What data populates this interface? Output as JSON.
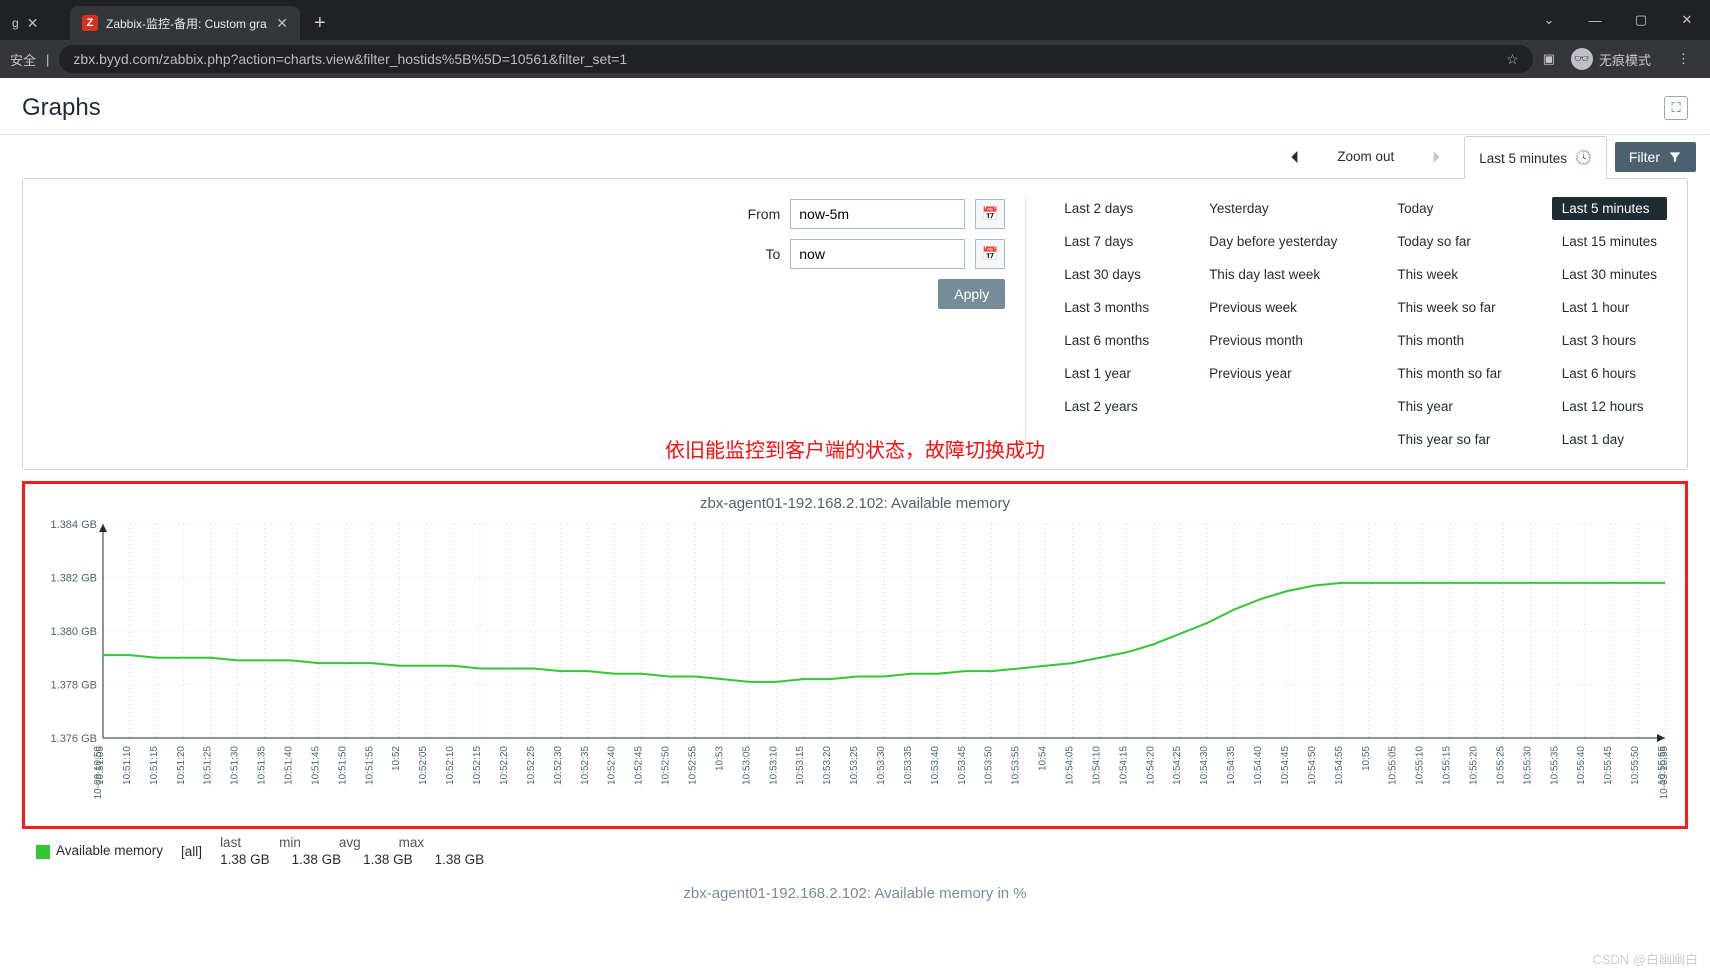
{
  "browser": {
    "tab1_close": "✕",
    "active_tab_title": "Zabbix-监控-备用: Custom gra",
    "newtab": "+",
    "win_min": "—",
    "win_max": "▢",
    "win_close": "✕",
    "addr_prefix": "安全",
    "url": "zbx.byyd.com/zabbix.php?action=charts.view&filter_hostids%5B%5D=10561&filter_set=1",
    "star": "☆",
    "ext": "▣",
    "incognito": "无痕模式",
    "menu": "⋮",
    "dropdown": "⌄"
  },
  "page": {
    "title": "Graphs",
    "fullscreen_icon": "⛶"
  },
  "toolbar": {
    "prev": "‹",
    "zoom": "Zoom out",
    "next": "›",
    "time_label": "Last 5 minutes",
    "filter_label": "Filter"
  },
  "filter": {
    "from_label": "From",
    "from_value": "now-5m",
    "to_label": "To",
    "to_value": "now",
    "apply": "Apply"
  },
  "presets": {
    "col1": [
      "Last 2 days",
      "Last 7 days",
      "Last 30 days",
      "Last 3 months",
      "Last 6 months",
      "Last 1 year",
      "Last 2 years"
    ],
    "col2": [
      "Yesterday",
      "Day before yesterday",
      "This day last week",
      "Previous week",
      "Previous month",
      "Previous year"
    ],
    "col3": [
      "Today",
      "Today so far",
      "This week",
      "This week so far",
      "This month",
      "This month so far",
      "This year",
      "This year so far"
    ],
    "col4": [
      "Last 5 minutes",
      "Last 15 minutes",
      "Last 30 minutes",
      "Last 1 hour",
      "Last 3 hours",
      "Last 6 hours",
      "Last 12 hours",
      "Last 1 day"
    ],
    "selected": "Last 5 minutes"
  },
  "annotation": "依旧能监控到客户端的状态，故障切换成功",
  "legend": {
    "series": "Available memory",
    "scope": "[all]",
    "headers": [
      "last",
      "min",
      "avg",
      "max"
    ],
    "values": [
      "1.38 GB",
      "1.38 GB",
      "1.38 GB",
      "1.38 GB"
    ]
  },
  "chart2_title": "zbx-agent01-192.168.2.102: Available memory in %",
  "watermark": "CSDN @白幽幽白",
  "chart_data": {
    "type": "line",
    "title": "zbx-agent01-192.168.2.102: Available memory",
    "xlabel": "",
    "ylabel": "",
    "y_ticks": [
      "1.376 GB",
      "1.378 GB",
      "1.380 GB",
      "1.382 GB",
      "1.384 GB"
    ],
    "ylim": [
      1.376,
      1.384
    ],
    "x_left_label": "10-09 10:50",
    "x_right_label": "10-09 10:55",
    "categories": [
      "10:51:05",
      "10:51:10",
      "10:51:15",
      "10:51:20",
      "10:51:25",
      "10:51:30",
      "10:51:35",
      "10:51:40",
      "10:51:45",
      "10:51:50",
      "10:51:55",
      "10:52",
      "10:52:05",
      "10:52:10",
      "10:52:15",
      "10:52:20",
      "10:52:25",
      "10:52:30",
      "10:52:35",
      "10:52:40",
      "10:52:45",
      "10:52:50",
      "10:52:55",
      "10:53",
      "10:53:05",
      "10:53:10",
      "10:53:15",
      "10:53:20",
      "10:53:25",
      "10:53:30",
      "10:53:35",
      "10:53:40",
      "10:53:45",
      "10:53:50",
      "10:53:55",
      "10:54",
      "10:54:05",
      "10:54:10",
      "10:54:15",
      "10:54:20",
      "10:54:25",
      "10:54:30",
      "10:54:35",
      "10:54:40",
      "10:54:45",
      "10:54:50",
      "10:54:55",
      "10:55",
      "10:55:05",
      "10:55:10",
      "10:55:15",
      "10:55:20",
      "10:55:25",
      "10:55:30",
      "10:55:35",
      "10:55:40",
      "10:55:45",
      "10:55:50",
      "10:55:55"
    ],
    "series": [
      {
        "name": "Available memory",
        "color": "#34c634",
        "values": [
          1.3791,
          1.3791,
          1.379,
          1.379,
          1.379,
          1.3789,
          1.3789,
          1.3789,
          1.3788,
          1.3788,
          1.3788,
          1.3787,
          1.3787,
          1.3787,
          1.3786,
          1.3786,
          1.3786,
          1.3785,
          1.3785,
          1.3784,
          1.3784,
          1.3783,
          1.3783,
          1.3782,
          1.3781,
          1.3781,
          1.3782,
          1.3782,
          1.3783,
          1.3783,
          1.3784,
          1.3784,
          1.3785,
          1.3785,
          1.3786,
          1.3787,
          1.3788,
          1.379,
          1.3792,
          1.3795,
          1.3799,
          1.3803,
          1.3808,
          1.3812,
          1.3815,
          1.3817,
          1.3818,
          1.3818,
          1.3818,
          1.3818,
          1.3818,
          1.3818,
          1.3818,
          1.3818,
          1.3818,
          1.3818,
          1.3818,
          1.3818,
          1.3818
        ]
      }
    ]
  }
}
